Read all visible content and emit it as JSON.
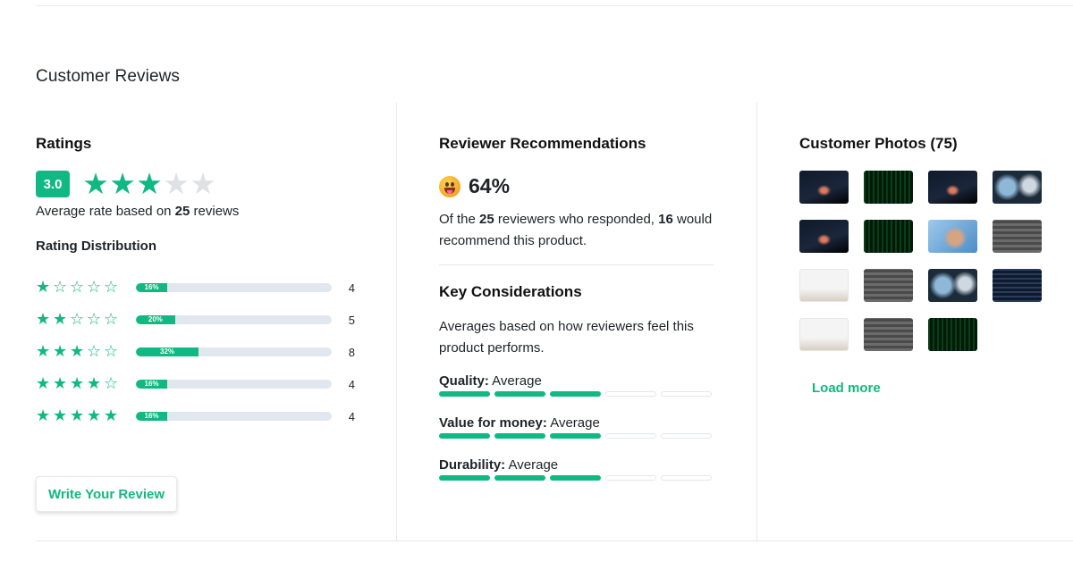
{
  "section_title": "Customer Reviews",
  "ratings": {
    "title": "Ratings",
    "average": "3.0",
    "average_value": 3,
    "max_stars": 5,
    "avg_text_prefix": "Average rate based on ",
    "review_count": "25",
    "avg_text_suffix": " reviews",
    "distribution_title": "Rating Distribution",
    "distribution": [
      {
        "stars": 1,
        "percent_label": "16%",
        "percent": 16,
        "count": "4"
      },
      {
        "stars": 2,
        "percent_label": "20%",
        "percent": 20,
        "count": "5"
      },
      {
        "stars": 3,
        "percent_label": "32%",
        "percent": 32,
        "count": "8"
      },
      {
        "stars": 4,
        "percent_label": "16%",
        "percent": 16,
        "count": "4"
      },
      {
        "stars": 5,
        "percent_label": "16%",
        "percent": 16,
        "count": "4"
      }
    ],
    "write_review_label": "Write Your Review"
  },
  "recommendations": {
    "title": "Reviewer Recommendations",
    "percent": "64%",
    "text_prefix": "Of the ",
    "responded": "25",
    "text_middle": " reviewers who responded, ",
    "recommend": "16",
    "text_suffix": " would recommend this product.",
    "key_title": "Key Considerations",
    "key_desc": "Averages based on how reviewers feel this product performs.",
    "metrics": [
      {
        "label": "Quality:",
        "value": "Average",
        "level": 3,
        "max": 5
      },
      {
        "label": "Value for money:",
        "value": "Average",
        "level": 3,
        "max": 5
      },
      {
        "label": "Durability:",
        "value": "Average",
        "level": 3,
        "max": 5
      }
    ]
  },
  "photos": {
    "title": "Customer Photos (75)",
    "items": [
      "laptop-dark",
      "matrix",
      "laptop-dark",
      "robot",
      "laptop-dark",
      "matrix",
      "hand",
      "keyboard",
      "desk-light",
      "keyboard",
      "robot",
      "code",
      "desk-light",
      "keyboard",
      "matrix"
    ],
    "load_more_label": "Load more"
  },
  "colors": {
    "accent": "#10b981",
    "track": "#e1e7ef",
    "star_off": "#dfe2e5"
  }
}
